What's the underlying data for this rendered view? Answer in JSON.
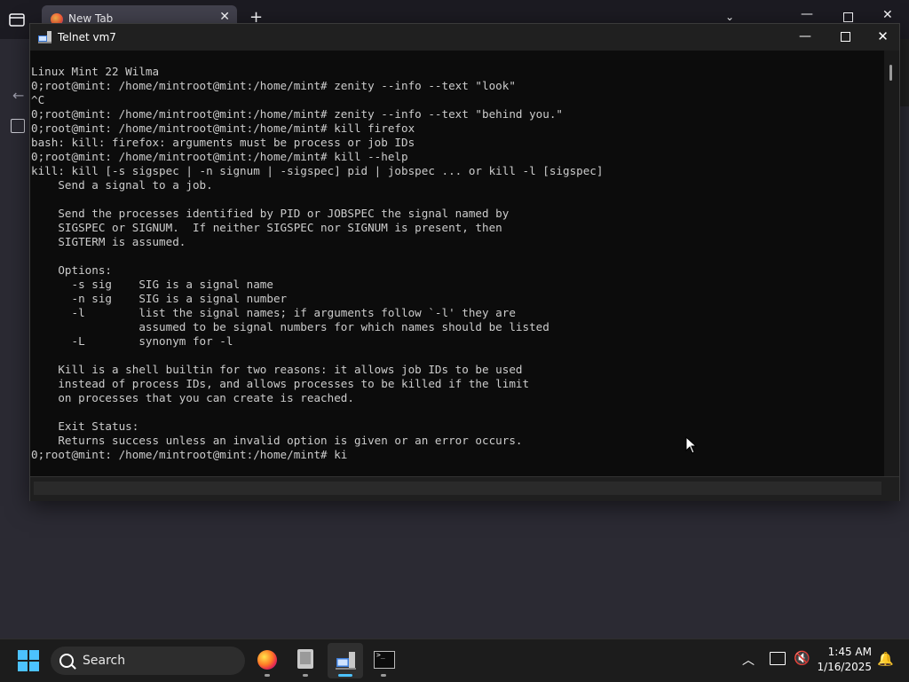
{
  "browser": {
    "tab_title": "New Tab",
    "tab_close": "✕",
    "new_tab": "+",
    "list_tabs": "⌄",
    "win_min": "—",
    "win_close": "✕",
    "back": "←"
  },
  "telnet": {
    "title": "Telnet vm7",
    "min": "—",
    "close": "✕",
    "lines": [
      "Linux Mint 22 Wilma",
      "0;root@mint: /home/mintroot@mint:/home/mint# zenity --info --text \"look\"",
      "^C",
      "0;root@mint: /home/mintroot@mint:/home/mint# zenity --info --text \"behind you.\"",
      "0;root@mint: /home/mintroot@mint:/home/mint# kill firefox",
      "bash: kill: firefox: arguments must be process or job IDs",
      "0;root@mint: /home/mintroot@mint:/home/mint# kill --help",
      "kill: kill [-s sigspec | -n signum | -sigspec] pid | jobspec ... or kill -l [sigspec]",
      "    Send a signal to a job.",
      "",
      "    Send the processes identified by PID or JOBSPEC the signal named by",
      "    SIGSPEC or SIGNUM.  If neither SIGSPEC nor SIGNUM is present, then",
      "    SIGTERM is assumed.",
      "",
      "    Options:",
      "      -s sig    SIG is a signal name",
      "      -n sig    SIG is a signal number",
      "      -l        list the signal names; if arguments follow `-l' they are",
      "                assumed to be signal numbers for which names should be listed",
      "      -L        synonym for -l",
      "",
      "    Kill is a shell builtin for two reasons: it allows job IDs to be used",
      "    instead of process IDs, and allows processes to be killed if the limit",
      "    on processes that you can create is reached.",
      "",
      "    Exit Status:",
      "    Returns success unless an invalid option is given or an error occurs.",
      "0;root@mint: /home/mintroot@mint:/home/mint# ki"
    ]
  },
  "taskbar": {
    "search_label": "Search",
    "tray_chevron": "︿",
    "time": "1:45 AM",
    "date": "1/16/2025",
    "volume_icon": "🔇",
    "bell_icon": "🔔",
    "apps": [
      "firefox-icon",
      "file-manager-icon",
      "telnet-icon",
      "terminal-icon"
    ]
  }
}
